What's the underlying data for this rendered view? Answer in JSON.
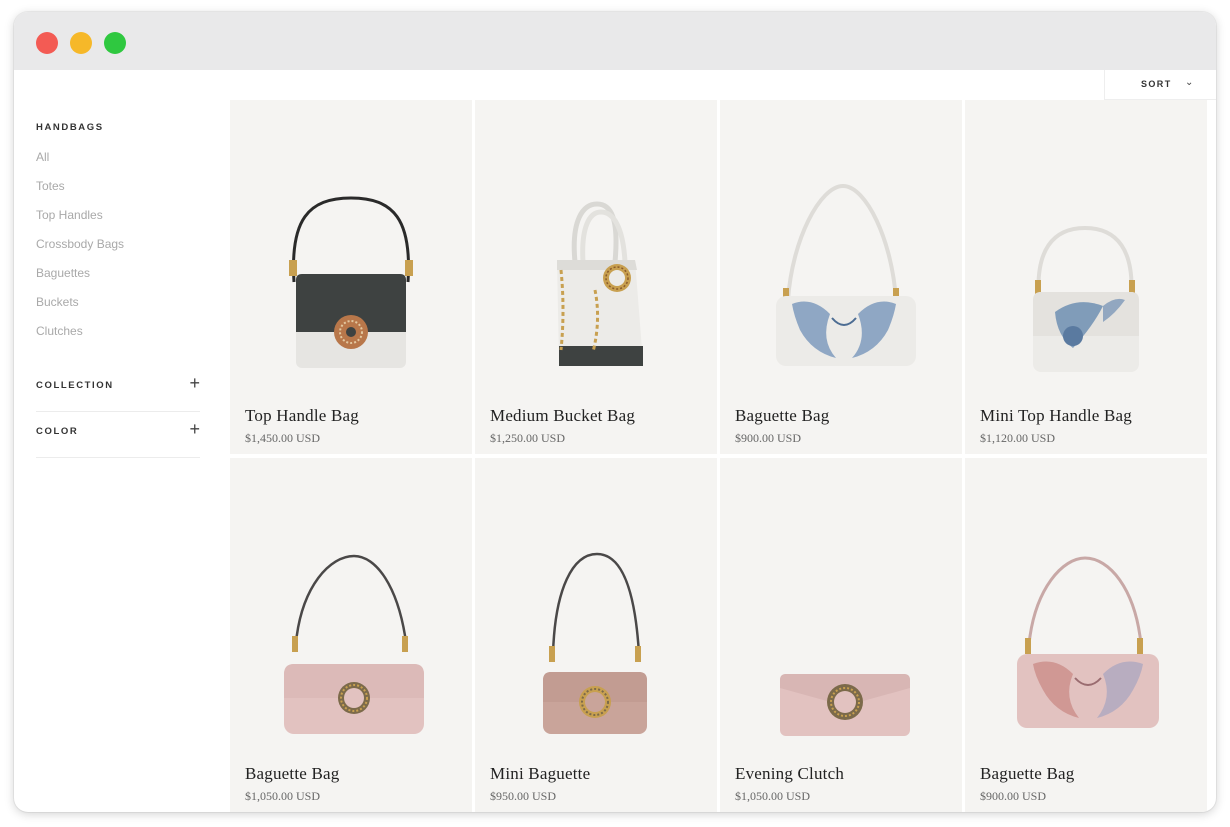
{
  "sidebar": {
    "heading": "HANDBAGS",
    "links": [
      "All",
      "Totes",
      "Top Handles",
      "Crossbody Bags",
      "Baguettes",
      "Buckets",
      "Clutches"
    ],
    "filters": [
      {
        "label": "COLLECTION",
        "toggle": "+"
      },
      {
        "label": "COLOR",
        "toggle": "+"
      }
    ]
  },
  "sort": {
    "label": "SORT",
    "chevron": "⌄"
  },
  "products": [
    {
      "name": "Top Handle Bag",
      "price": "$1,450.00 USD",
      "image": "top-handle-bag-black-white"
    },
    {
      "name": "Medium Bucket Bag",
      "price": "$1,250.00 USD",
      "image": "bucket-bag-white-chain"
    },
    {
      "name": "Baguette Bag",
      "price": "$900.00 USD",
      "image": "baguette-bag-white-blue-print"
    },
    {
      "name": "Mini Top Handle Bag",
      "price": "$1,120.00 USD",
      "image": "mini-top-handle-white-blue"
    },
    {
      "name": "Baguette Bag",
      "price": "$1,050.00 USD",
      "image": "baguette-bag-pink"
    },
    {
      "name": "Mini Baguette",
      "price": "$950.00 USD",
      "image": "mini-baguette-mauve"
    },
    {
      "name": "Evening Clutch",
      "price": "$1,050.00 USD",
      "image": "evening-clutch-pink"
    },
    {
      "name": "Baguette Bag",
      "price": "$900.00 USD",
      "image": "baguette-bag-pink-print"
    }
  ],
  "colors": {
    "card_bg": "#f5f4f2",
    "black_leather": "#3e4241",
    "white_leather": "#ecebe8",
    "pink_leather": "#e2c2c0",
    "mauve_leather": "#c9a49a",
    "gold": "#c8a050",
    "print_blue": "#6f8fb3"
  }
}
